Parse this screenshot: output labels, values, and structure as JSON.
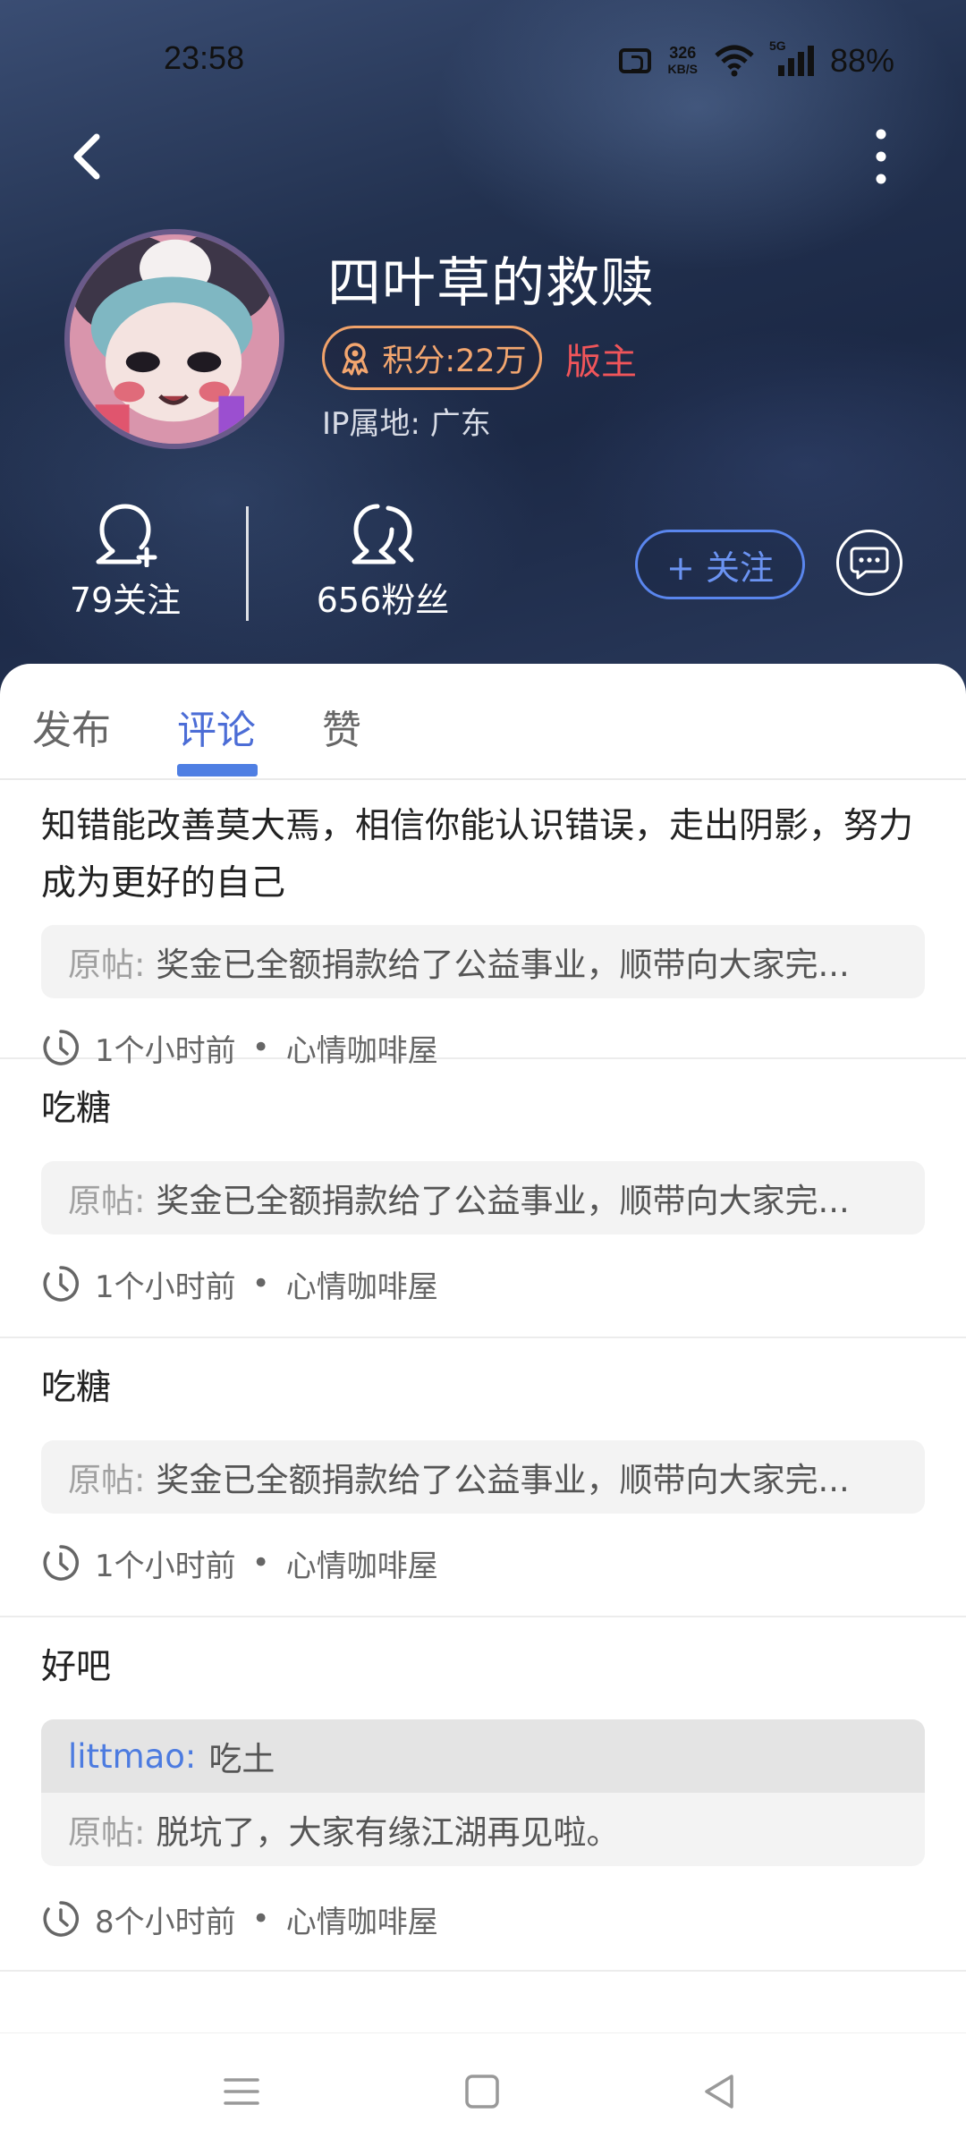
{
  "status_bar": {
    "time": "23:58",
    "speed_value": "326",
    "speed_unit": "KB/S",
    "network": "5G",
    "battery": "88%"
  },
  "header": {
    "back_icon": "chevron-left-icon",
    "more_icon": "more-vertical-icon"
  },
  "profile": {
    "username": "四叶草的救赎",
    "points": "积分:22万",
    "role": "版主",
    "ip_location": "IP属地: 广东",
    "following": "79关注",
    "followers": "656粉丝",
    "follow_button": "+ 关注",
    "colors": {
      "accent": "#4f7fe3",
      "points": "#f3a66f",
      "role": "#f0555a"
    }
  },
  "tabs": [
    {
      "label": "发布",
      "active": false
    },
    {
      "label": "评论",
      "active": true
    },
    {
      "label": "赞",
      "active": false
    }
  ],
  "comments": [
    {
      "text": "知错能改善莫大焉，相信你能认识错误，走出阴影，努力成为更好的自己",
      "origin_label": "原帖:",
      "origin": "奖金已全额捐款给了公益事业，顺带向大家完...",
      "time": "1个小时前",
      "forum": "心情咖啡屋"
    },
    {
      "text": "吃糖",
      "origin_label": "原帖:",
      "origin": "奖金已全额捐款给了公益事业，顺带向大家完...",
      "time": "1个小时前",
      "forum": "心情咖啡屋"
    },
    {
      "text": "吃糖",
      "origin_label": "原帖:",
      "origin": "奖金已全额捐款给了公益事业，顺带向大家完...",
      "time": "1个小时前",
      "forum": "心情咖啡屋"
    },
    {
      "text": "好吧",
      "reply_user": "littmao:",
      "reply_text": "吃土",
      "origin_label": "原帖:",
      "origin": "脱坑了，大家有缘江湖再见啦。",
      "time": "8个小时前",
      "forum": "心情咖啡屋"
    }
  ],
  "meta_separator": "•",
  "navbar": {
    "menu_icon": "menu-icon",
    "home_icon": "square-home-icon",
    "back_icon": "triangle-back-icon"
  }
}
